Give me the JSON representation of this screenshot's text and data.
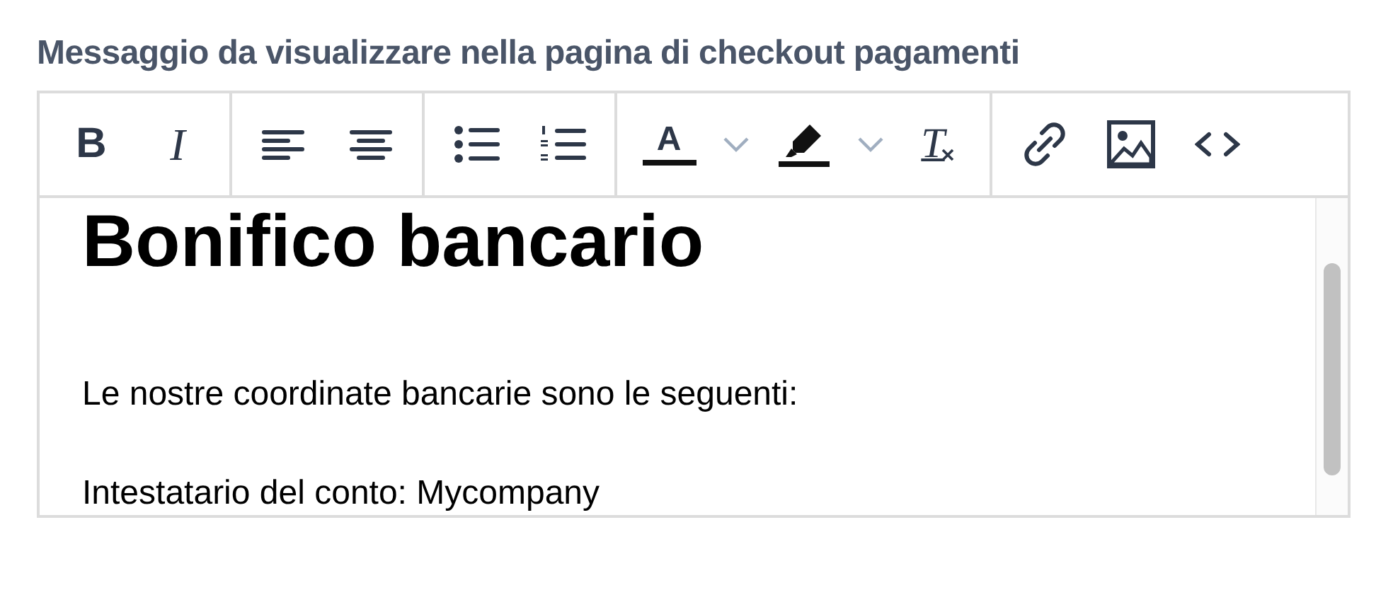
{
  "title": "Messaggio da visualizzare nella pagina di checkout pagamenti",
  "toolbar": [
    [
      {
        "kind": "bold",
        "glyph": "B"
      },
      {
        "kind": "italic",
        "glyph": "I"
      }
    ],
    [
      {
        "kind": "align-left"
      },
      {
        "kind": "align-center"
      }
    ],
    [
      {
        "kind": "bullet-list"
      },
      {
        "kind": "numbered-list"
      }
    ],
    [
      {
        "kind": "text-color",
        "glyph": "A"
      },
      {
        "kind": "caret"
      },
      {
        "kind": "highlight"
      },
      {
        "kind": "caret"
      },
      {
        "kind": "clear-format",
        "glyph": "T"
      }
    ],
    [
      {
        "kind": "link"
      },
      {
        "kind": "image"
      },
      {
        "kind": "code"
      }
    ]
  ],
  "content": [
    {
      "kind": "heading",
      "text": "Bonifico bancario"
    },
    {
      "kind": "paragraph",
      "text": "Le nostre coordinate bancarie sono le seguenti:"
    },
    {
      "kind": "paragraph",
      "text": "Intestatario del conto: Mycompany"
    }
  ]
}
